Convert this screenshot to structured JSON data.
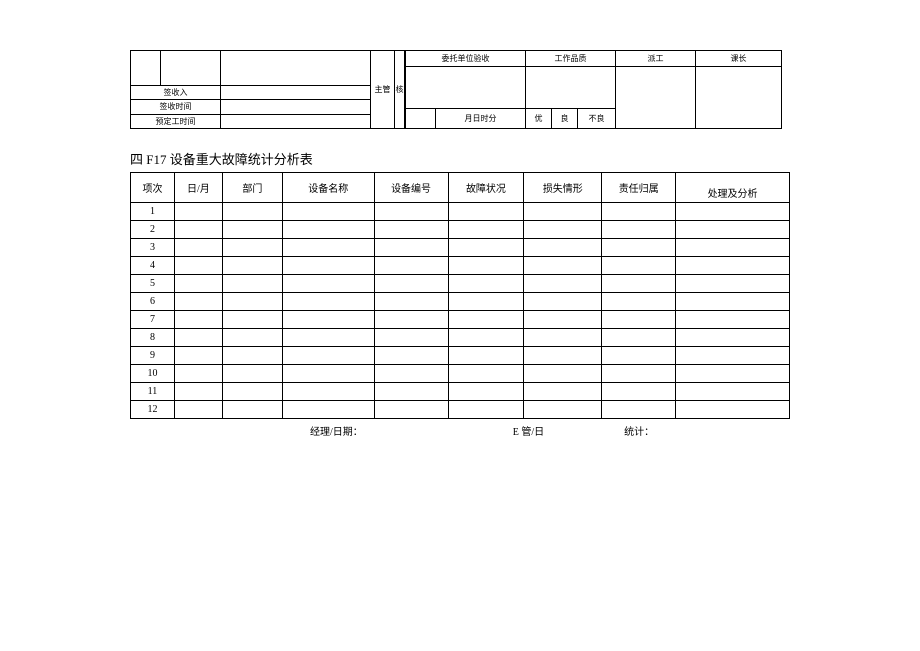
{
  "upper": {
    "left_labels": {
      "sign_in": "签收入",
      "sign_time": "签收时间",
      "scheduled_time": "预定工时间",
      "supervisor": "主管",
      "check": "核"
    },
    "right": {
      "headers": {
        "client_accept": "委托单位验收",
        "work_quality": "工作品质",
        "dispatch": "派工",
        "leader": "课长"
      },
      "footer": {
        "datetime": "月日时分",
        "excellent": "优",
        "good": "良",
        "poor": "不良"
      }
    }
  },
  "section_title": "四 F17 设备重大故障统计分析表",
  "main": {
    "headers": {
      "seq": "项次",
      "date": "日/月",
      "dept": "部门",
      "equip_name": "设备名称",
      "equip_no": "设备编号",
      "fault": "故障状况",
      "loss": "损失情形",
      "resp": "责任归属",
      "analysis": "处理及分析"
    },
    "rows": [
      {
        "seq": "1"
      },
      {
        "seq": "2"
      },
      {
        "seq": "3"
      },
      {
        "seq": "4"
      },
      {
        "seq": "5"
      },
      {
        "seq": "6"
      },
      {
        "seq": "7"
      },
      {
        "seq": "8"
      },
      {
        "seq": "9"
      },
      {
        "seq": "10"
      },
      {
        "seq": "11"
      },
      {
        "seq": "12"
      }
    ]
  },
  "footer": {
    "manager": "经理/日期：",
    "pipe": "E 管/日",
    "stat": "统计："
  }
}
